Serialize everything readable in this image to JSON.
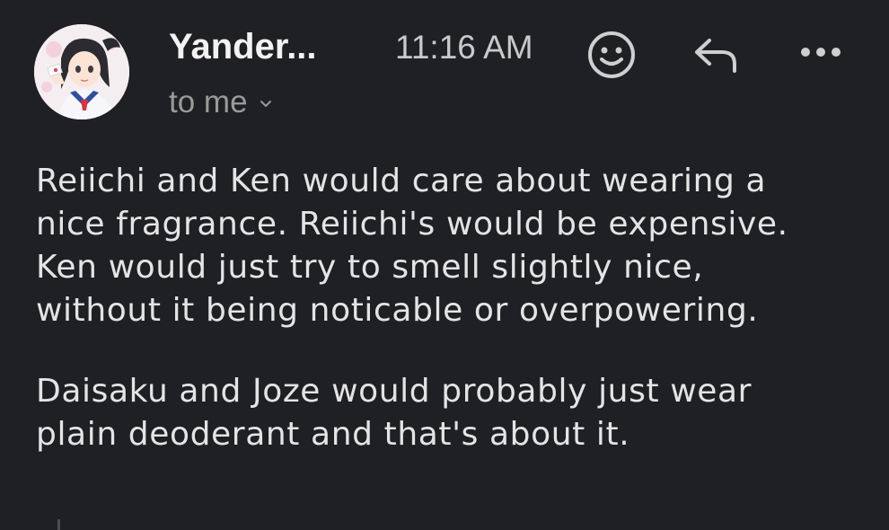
{
  "header": {
    "sender": "Yander...",
    "time": "11:16 AM",
    "recipient": "to me"
  },
  "icons": {
    "avatar": "avatar-image",
    "emoji": "smiley-face-icon",
    "reply": "reply-arrow-icon",
    "more": "more-horizontal-icon",
    "chevron": "chevron-down-icon"
  },
  "message": {
    "paragraphs": [
      "Reiichi and Ken would care about wearing a\nnice fragrance. Reiichi's would be expensive.\nKen would just try to smell slightly nice,\nwithout it being noticable or overpowering.",
      "Daisaku and Joze would probably just wear\nplain deoderant and that's about it."
    ]
  },
  "colors": {
    "background": "#1f2023",
    "text": "#e4e4e4",
    "muted": "#9a9a9a",
    "icon": "#cfcfcf"
  }
}
